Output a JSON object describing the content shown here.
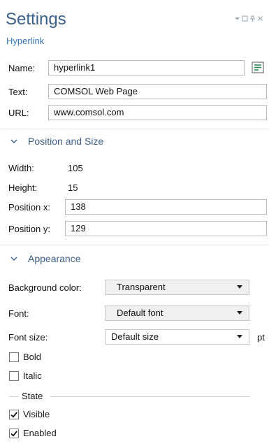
{
  "header": {
    "title": "Settings",
    "subtitle": "Hyperlink"
  },
  "window_controls": [
    "chevron-down-icon",
    "maximize-icon",
    "pin-icon",
    "close-icon"
  ],
  "fields": {
    "name": {
      "label": "Name:",
      "value": "hyperlink1"
    },
    "text": {
      "label": "Text:",
      "value": "COMSOL Web Page"
    },
    "url": {
      "label": "URL:",
      "value": "www.comsol.com"
    }
  },
  "position_size": {
    "heading": "Position and Size",
    "width": {
      "label": "Width:",
      "value": "105"
    },
    "height": {
      "label": "Height:",
      "value": "15"
    },
    "position_x": {
      "label": "Position x:",
      "value": "138"
    },
    "position_y": {
      "label": "Position y:",
      "value": "129"
    }
  },
  "appearance": {
    "heading": "Appearance",
    "background_color": {
      "label": "Background color:",
      "value": "Transparent"
    },
    "font": {
      "label": "Font:",
      "value": "Default font"
    },
    "font_size": {
      "label": "Font size:",
      "value": "Default size",
      "unit": "pt"
    },
    "bold": {
      "label": "Bold",
      "checked": false
    },
    "italic": {
      "label": "Italic",
      "checked": false
    }
  },
  "state": {
    "heading": "State",
    "visible": {
      "label": "Visible",
      "checked": true
    },
    "enabled": {
      "label": "Enabled",
      "checked": true
    }
  },
  "colors": {
    "title": "#3b5f8a",
    "subtitle": "#3a78b8",
    "accent_icon": "#2e8b57"
  }
}
